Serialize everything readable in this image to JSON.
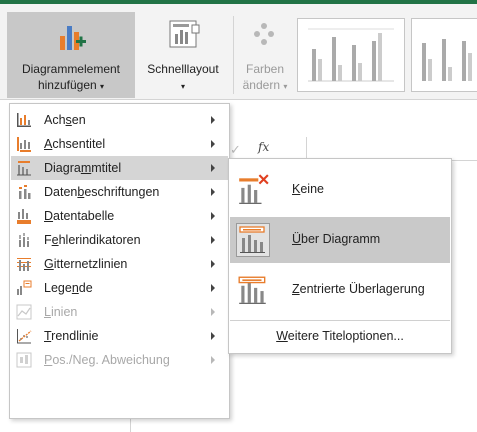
{
  "ribbon": {
    "add_element_line1": "Diagrammelement",
    "add_element_line2": "hinzufügen",
    "quick_layout": "Schnelllayout",
    "colors_line1": "Farben",
    "colors_line2": "ändern",
    "dropdown_arrow": "▾"
  },
  "formula_bar": {
    "check": "✓",
    "fx": "fx"
  },
  "menu": {
    "items": [
      {
        "pre": "Ach",
        "key": "s",
        "post": "en",
        "icon": "axes-icon",
        "disabled": false
      },
      {
        "pre": "",
        "key": "A",
        "post": "chsentitel",
        "icon": "axis-titles-icon",
        "disabled": false
      },
      {
        "pre": "Diagra",
        "key": "m",
        "post": "mtitel",
        "icon": "chart-title-icon",
        "disabled": false
      },
      {
        "pre": "Daten",
        "key": "b",
        "post": "eschriftungen",
        "icon": "data-labels-icon",
        "disabled": false
      },
      {
        "pre": "",
        "key": "D",
        "post": "atentabelle",
        "icon": "data-table-icon",
        "disabled": false
      },
      {
        "pre": "F",
        "key": "e",
        "post": "hlerindikatoren",
        "icon": "error-bars-icon",
        "disabled": false
      },
      {
        "pre": "",
        "key": "G",
        "post": "itternetzlinien",
        "icon": "gridlines-icon",
        "disabled": false
      },
      {
        "pre": "Lege",
        "key": "n",
        "post": "de",
        "icon": "legend-icon",
        "disabled": false
      },
      {
        "pre": "",
        "key": "L",
        "post": "inien",
        "icon": "lines-icon",
        "disabled": true
      },
      {
        "pre": "",
        "key": "T",
        "post": "rendlinie",
        "icon": "trendline-icon",
        "disabled": false
      },
      {
        "pre": "",
        "key": "P",
        "post": "os./Neg. Abweichung",
        "icon": "up-down-bars-icon",
        "disabled": true
      }
    ]
  },
  "submenu": {
    "items": [
      {
        "pre": "",
        "key": "K",
        "post": "eine",
        "icon": "no-title-icon"
      },
      {
        "pre": "",
        "key": "Ü",
        "post": "ber Diagramm",
        "icon": "above-chart-icon"
      },
      {
        "pre": "",
        "key": "Z",
        "post": "entrierte Überlagerung",
        "icon": "centered-overlay-icon"
      }
    ],
    "more": {
      "pre": "",
      "key": "W",
      "post": "eitere Titeloptionen..."
    }
  },
  "colors": {
    "accent": "#217346",
    "highlight": "#d5d5d5",
    "icon_orange": "#e87d2c",
    "icon_green": "#217346"
  }
}
